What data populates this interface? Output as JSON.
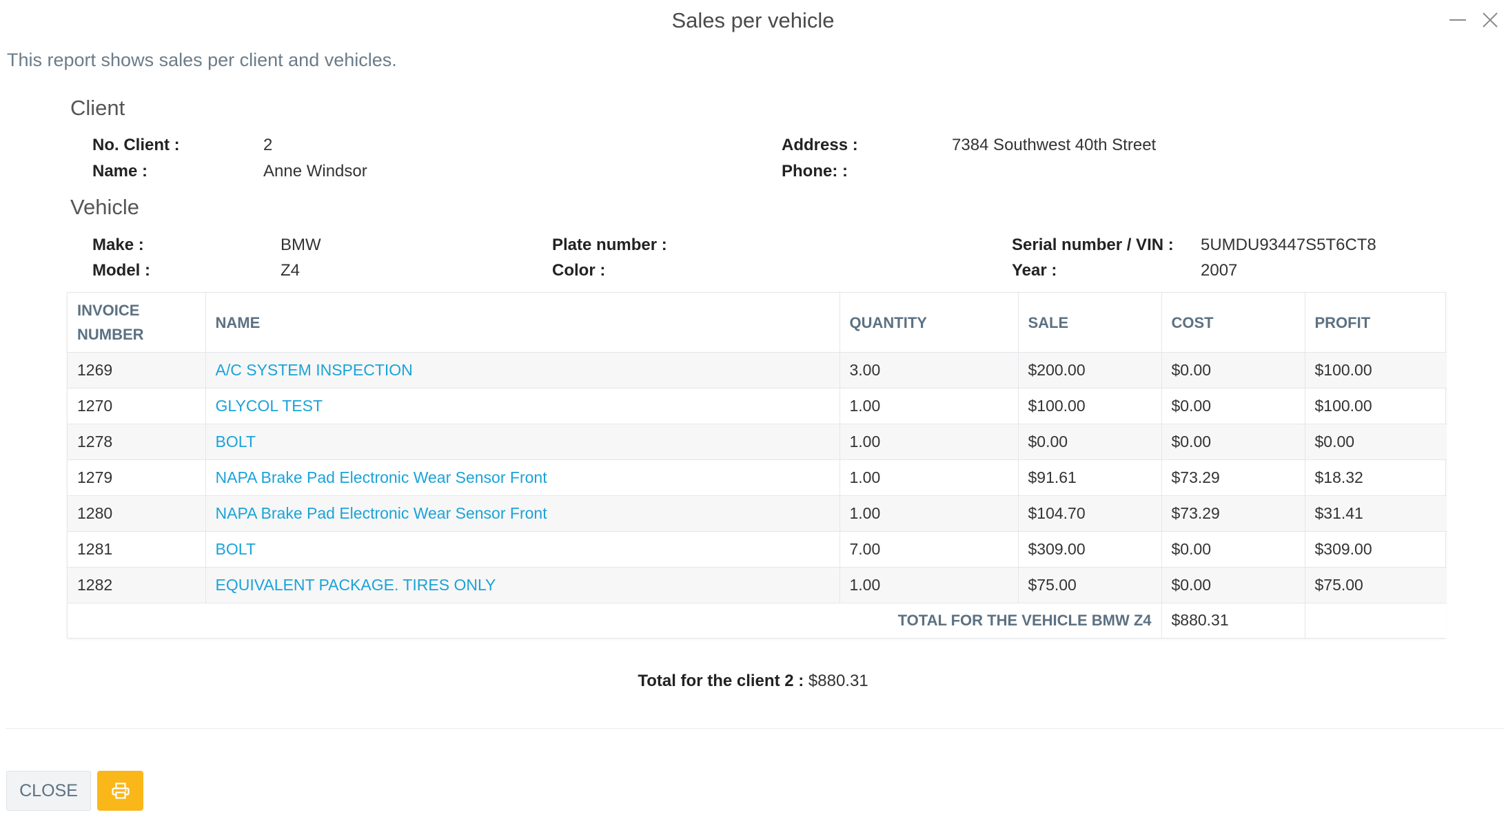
{
  "dialog": {
    "title": "Sales per vehicle",
    "subtitle": "This report shows sales per client and vehicles."
  },
  "client_section": {
    "title": "Client",
    "no_client_label": "No. Client :",
    "no_client_value": "2",
    "name_label": "Name :",
    "name_value": "Anne Windsor",
    "address_label": "Address :",
    "address_value": "7384 Southwest 40th Street",
    "phone_label": "Phone: :",
    "phone_value": ""
  },
  "vehicle_section": {
    "title": "Vehicle",
    "make_label": "Make :",
    "make_value": "BMW",
    "model_label": "Model :",
    "model_value": "Z4",
    "plate_label": "Plate number :",
    "plate_value": "",
    "color_label": "Color :",
    "color_value": "",
    "vin_label": "Serial number / VIN :",
    "vin_value": "5UMDU93447S5T6CT8",
    "year_label": "Year :",
    "year_value": "2007"
  },
  "table": {
    "headers": {
      "invoice_line1": "INVOICE",
      "invoice_line2": "NUMBER",
      "name": "NAME",
      "quantity": "QUANTITY",
      "sale": "SALE",
      "cost": "COST",
      "profit": "PROFIT"
    },
    "rows": [
      {
        "invoice": "1269",
        "name": "A/C SYSTEM INSPECTION",
        "quantity": "3.00",
        "sale": "$200.00",
        "cost": "$0.00",
        "profit": "$100.00"
      },
      {
        "invoice": "1270",
        "name": "GLYCOL TEST",
        "quantity": "1.00",
        "sale": "$100.00",
        "cost": "$0.00",
        "profit": "$100.00"
      },
      {
        "invoice": "1278",
        "name": "BOLT",
        "quantity": "1.00",
        "sale": "$0.00",
        "cost": "$0.00",
        "profit": "$0.00"
      },
      {
        "invoice": "1279",
        "name": "NAPA Brake Pad Electronic Wear Sensor Front",
        "quantity": "1.00",
        "sale": "$91.61",
        "cost": "$73.29",
        "profit": "$18.32"
      },
      {
        "invoice": "1280",
        "name": "NAPA Brake Pad Electronic Wear Sensor Front",
        "quantity": "1.00",
        "sale": "$104.70",
        "cost": "$73.29",
        "profit": "$31.41"
      },
      {
        "invoice": "1281",
        "name": "BOLT",
        "quantity": "7.00",
        "sale": "$309.00",
        "cost": "$0.00",
        "profit": "$309.00"
      },
      {
        "invoice": "1282",
        "name": "EQUIVALENT PACKAGE. TIRES ONLY",
        "quantity": "1.00",
        "sale": "$75.00",
        "cost": "$0.00",
        "profit": "$75.00"
      }
    ],
    "total_label": "TOTAL FOR THE VEHICLE BMW Z4",
    "total_value": "$880.31"
  },
  "client_total": {
    "label": "Total for the client 2 :",
    "value": "$880.31"
  },
  "buttons": {
    "close_label": "CLOSE",
    "print_icon": "print-icon"
  },
  "colors": {
    "link": "#1aa3d9",
    "header_text": "#5c7182",
    "print_button": "#f9b71a"
  }
}
